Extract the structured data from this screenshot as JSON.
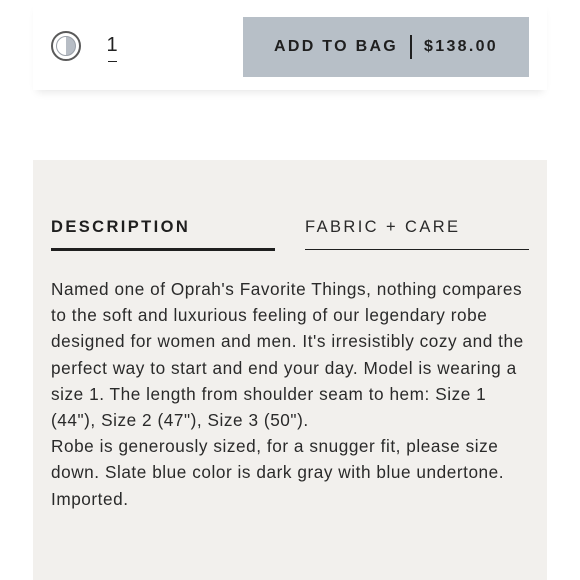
{
  "purchase_bar": {
    "quantity": "1",
    "add_to_bag_label": "ADD TO BAG",
    "price": "$138.00",
    "button_color": "#b7bfc7"
  },
  "tabs": [
    {
      "label": "DESCRIPTION",
      "active": true
    },
    {
      "label": "FABRIC + CARE",
      "active": false
    }
  ],
  "description": {
    "paragraph_1": "Named one of Oprah's Favorite Things, nothing compares to the soft and luxurious feeling of our legendary robe designed for women and men. It's irresistibly cozy and the perfect way to start and end your day. Model is wearing a size 1. The length from shoulder seam to hem: Size 1 (44\"), Size 2 (47\"), Size 3 (50\").",
    "paragraph_2": "Robe is generously sized, for a snugger fit, please size down. Slate blue color is dark gray with blue undertone. Imported."
  },
  "colors": {
    "panel_background": "#f2f0ed",
    "text": "#1f1f1f"
  }
}
